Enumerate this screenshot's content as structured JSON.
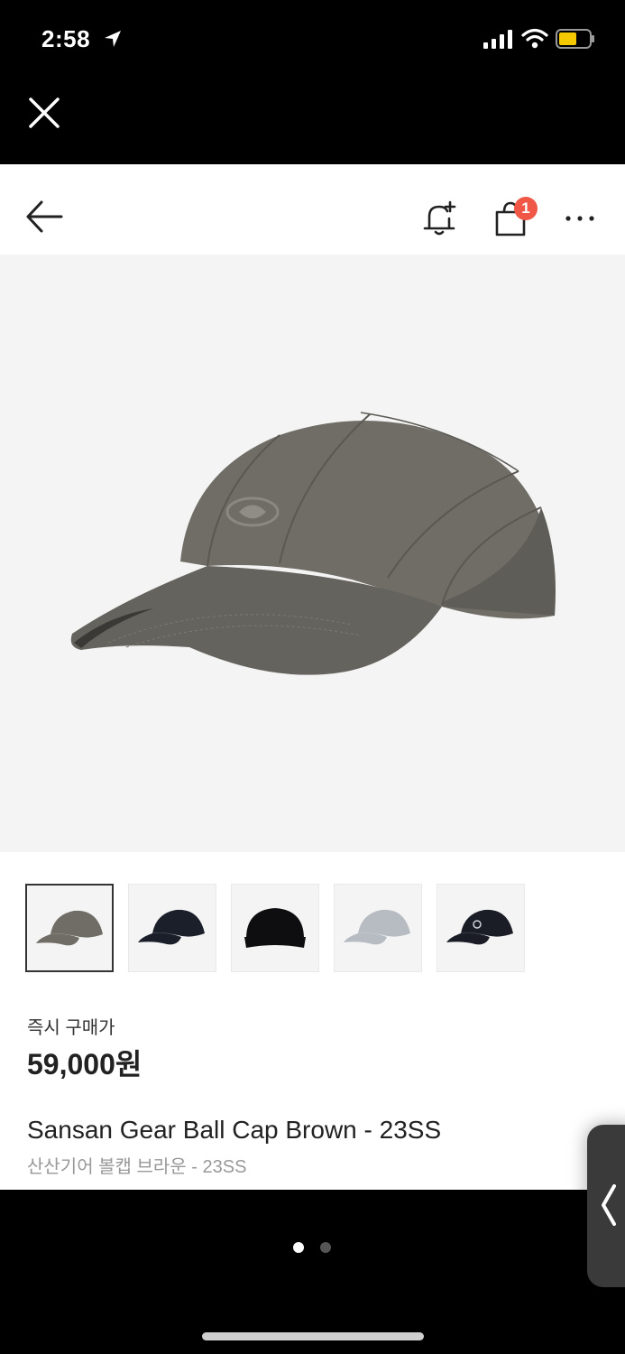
{
  "status_bar": {
    "time": "2:58"
  },
  "header": {
    "cart_count": "1"
  },
  "product": {
    "price_label": "즉시 구매가",
    "price": "59,000원",
    "name_en": "Sansan Gear Ball Cap Brown - 23SS",
    "name_ko": "산산기어 볼캡 브라운 - 23SS",
    "hero_cap_color": "#6f6d66",
    "thumbnails": [
      {
        "color": "#6f6d66",
        "selected": true
      },
      {
        "color": "#1b1f2a",
        "selected": false
      },
      {
        "color": "#0e0e10",
        "selected": false
      },
      {
        "color": "#b7bcc3",
        "selected": false
      },
      {
        "color": "#1a1d26",
        "selected": false
      }
    ]
  },
  "pager": {
    "pages": 2,
    "current": 1
  },
  "colors": {
    "badge": "#f15746",
    "hero_bg": "#f4f4f4"
  }
}
